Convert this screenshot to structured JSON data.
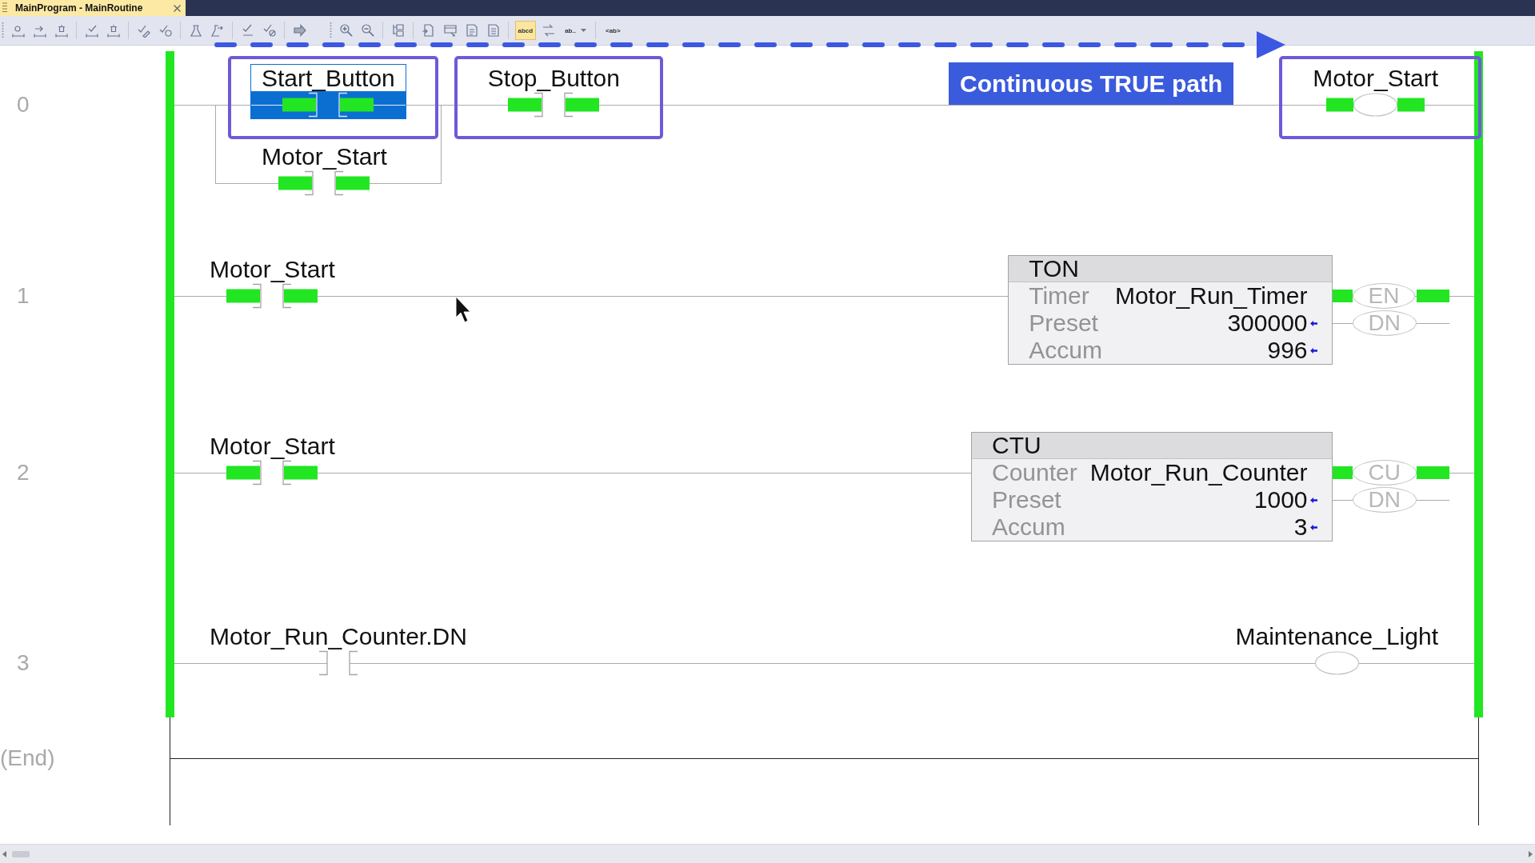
{
  "tab": {
    "title": "MainProgram - MainRoutine",
    "selected": true
  },
  "toolbar": {
    "strips": [
      {
        "groups": [
          {
            "buttons": [
              {
                "kind": "icon",
                "selected": false
              },
              {
                "kind": "icon",
                "selected": false
              },
              {
                "kind": "icon",
                "selected": false
              }
            ]
          },
          {
            "buttons": [
              {
                "kind": "icon",
                "selected": false
              },
              {
                "kind": "icon",
                "selected": false
              }
            ]
          },
          {
            "buttons": [
              {
                "kind": "icon",
                "selected": false
              },
              {
                "kind": "icon",
                "selected": false
              }
            ]
          },
          {
            "buttons": [
              {
                "kind": "icon",
                "selected": false
              },
              {
                "kind": "icon",
                "selected": false
              }
            ]
          },
          {
            "buttons": [
              {
                "kind": "icon",
                "selected": false
              },
              {
                "kind": "icon",
                "selected": false
              }
            ]
          },
          {
            "buttons": [
              {
                "kind": "icon",
                "selected": false
              }
            ]
          }
        ]
      },
      {
        "groups": [
          {
            "buttons": [
              {
                "kind": "icon",
                "selected": false
              },
              {
                "kind": "icon",
                "selected": false
              }
            ]
          },
          {
            "buttons": [
              {
                "kind": "icon",
                "selected": false
              }
            ]
          },
          {
            "buttons": [
              {
                "kind": "icon",
                "selected": false
              },
              {
                "kind": "icon",
                "selected": false
              },
              {
                "kind": "icon",
                "selected": false
              },
              {
                "kind": "icon",
                "selected": false
              }
            ]
          },
          {
            "buttons": [
              {
                "kind": "text",
                "label": "abcd",
                "selected": true
              },
              {
                "kind": "icon",
                "selected": false
              },
              {
                "kind": "dropdown",
                "label": "ab..",
                "selected": false
              }
            ]
          },
          {
            "buttons": [
              {
                "kind": "text",
                "label": "<ab>",
                "selected": false
              }
            ]
          }
        ]
      }
    ]
  },
  "annotation": {
    "callout": "Continuous TRUE path"
  },
  "rungs": [
    {
      "number": "0",
      "elements": [
        {
          "kind": "branch",
          "legs": [
            [
              {
                "kind": "contact",
                "tag": "Start_Button",
                "energized": true,
                "selected": true,
                "outlined": true
              }
            ],
            [
              {
                "kind": "contact",
                "tag": "Motor_Start",
                "energized": true,
                "selected": false,
                "outlined": false
              }
            ]
          ]
        },
        {
          "kind": "contact",
          "tag": "Stop_Button",
          "energized": true,
          "selected": false,
          "outlined": true
        },
        {
          "kind": "coil",
          "tag": "Motor_Start",
          "energized": true,
          "selected": false,
          "outlined": true
        }
      ]
    },
    {
      "number": "1",
      "elements": [
        {
          "kind": "contact",
          "tag": "Motor_Start",
          "energized": true,
          "selected": false,
          "outlined": false
        },
        {
          "kind": "block",
          "name": "TON",
          "selected": false,
          "outlined": false,
          "rows": [
            {
              "kind": "tag",
              "label": "Timer",
              "value": "Motor_Run_Timer"
            },
            {
              "kind": "number",
              "label": "Preset",
              "value": "300000"
            },
            {
              "kind": "number",
              "label": "Accum",
              "value": "996"
            }
          ],
          "outputs": [
            {
              "label": "EN",
              "energized": true
            },
            {
              "label": "DN",
              "energized": false
            }
          ]
        }
      ]
    },
    {
      "number": "2",
      "elements": [
        {
          "kind": "contact",
          "tag": "Motor_Start",
          "energized": true,
          "selected": false,
          "outlined": false
        },
        {
          "kind": "block",
          "name": "CTU",
          "selected": false,
          "outlined": false,
          "rows": [
            {
              "kind": "tag",
              "label": "Counter",
              "value": "Motor_Run_Counter"
            },
            {
              "kind": "number",
              "label": "Preset",
              "value": "1000"
            },
            {
              "kind": "number",
              "label": "Accum",
              "value": "3"
            }
          ],
          "outputs": [
            {
              "label": "CU",
              "energized": true
            },
            {
              "label": "DN",
              "energized": false
            }
          ]
        }
      ]
    },
    {
      "number": "3",
      "elements": [
        {
          "kind": "contact",
          "tag": "Motor_Run_Counter.DN",
          "energized": false,
          "selected": false,
          "outlined": false
        },
        {
          "kind": "coil",
          "tag": "Maintenance_Light",
          "energized": false,
          "selected": false,
          "outlined": false
        }
      ]
    }
  ],
  "end_marker": "(End)"
}
